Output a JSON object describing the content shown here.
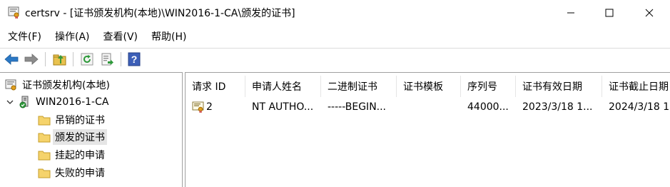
{
  "window": {
    "title": "certsrv - [证书颁发机构(本地)\\WIN2016-1-CA\\颁发的证书]"
  },
  "menu": [
    "文件(F)",
    "操作(A)",
    "查看(V)",
    "帮助(H)"
  ],
  "toolbar": {
    "icons": [
      "back-arrow-icon",
      "forward-arrow-icon",
      "up-folder-icon",
      "refresh-icon",
      "export-list-icon",
      "help-icon"
    ]
  },
  "tree": {
    "root": "证书颁发机构(本地)",
    "ca": "WIN2016-1-CA",
    "folders": [
      "吊销的证书",
      "颁发的证书",
      "挂起的申请",
      "失败的申请"
    ],
    "selected_index": 1
  },
  "list": {
    "columns": [
      "请求 ID",
      "申请人姓名",
      "二进制证书",
      "证书模板",
      "序列号",
      "证书有效日期",
      "证书截止日期"
    ],
    "rows": [
      {
        "request_id": "2",
        "requester": "NT AUTHO...",
        "binary_cert": "-----BEGIN...",
        "template": "",
        "serial": "44000...",
        "effective": "2023/3/18 1...",
        "expiry": "2024/3/18 1..."
      }
    ]
  },
  "colors": {
    "arrow_blue": "#2b78c5",
    "folder_yellow": "#f5d36b",
    "help_blue": "#3d5fb8",
    "selection_gray": "#e5e5e5"
  }
}
